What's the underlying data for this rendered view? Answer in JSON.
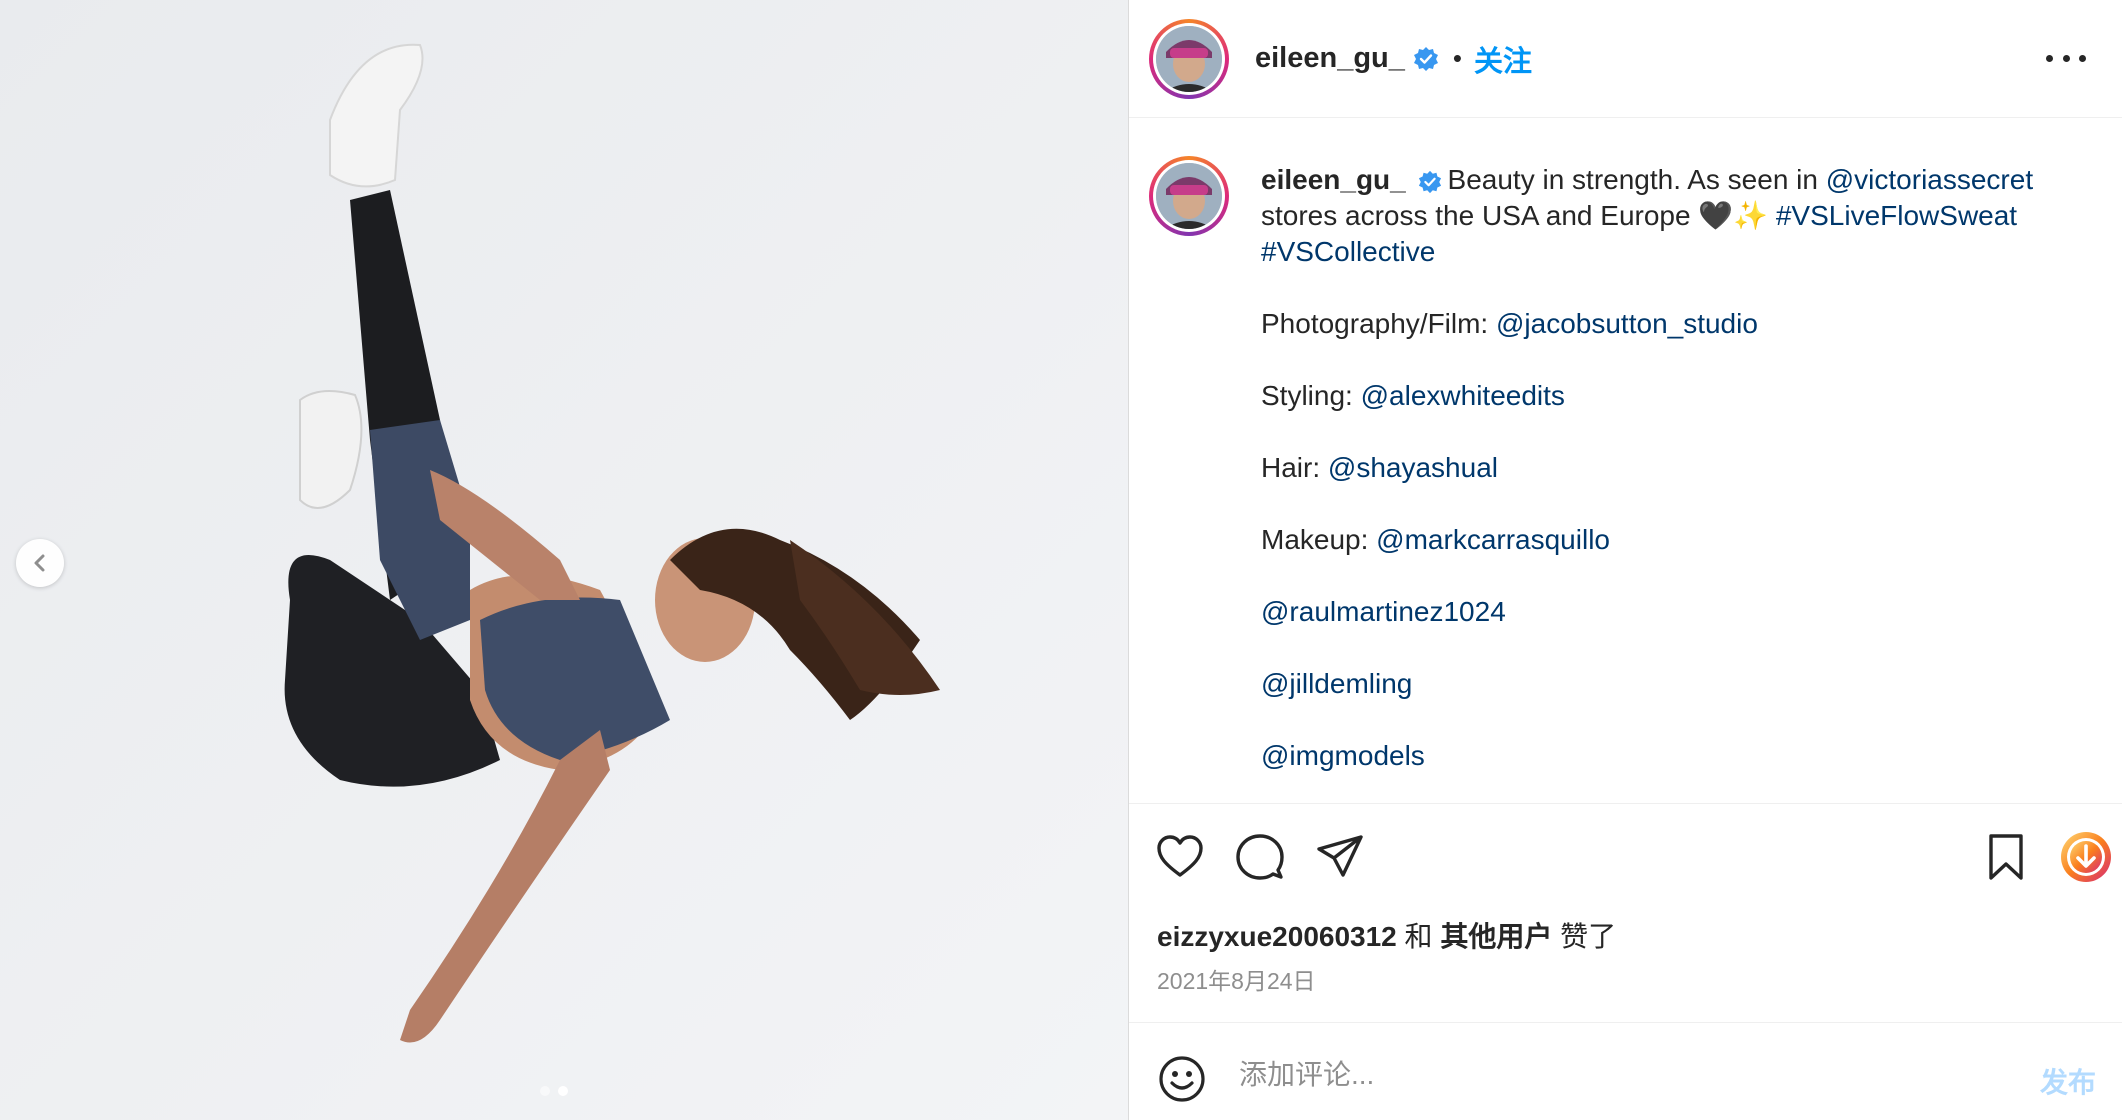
{
  "post": {
    "media": {
      "alt_description": "",
      "carousel_dots": 2,
      "active_dot": 2,
      "prev_icon": "chevron-left-icon"
    },
    "header": {
      "username": "eileen_gu_",
      "separator": "•",
      "follow_label": "关注",
      "more_icon": "more-horizontal-icon",
      "verified_icon": "verified-badge-icon"
    },
    "caption": {
      "username": "eileen_gu_",
      "line1_text": "Beauty in strength. As seen in ",
      "line1_mention": "@victoriassecret",
      "line2_text": "stores across the USA and Europe 🖤✨ ",
      "line2_hashtag": "#VSLiveFlowSweat",
      "line3_hashtag": "#VSCollective",
      "credits": [
        {
          "label": "Photography/Film: ",
          "mention": "@jacobsutton_studio"
        },
        {
          "label": "Styling: ",
          "mention": "@alexwhiteedits"
        },
        {
          "label": "Hair: ",
          "mention": "@shayashual"
        },
        {
          "label": "Makeup: ",
          "mention": "@markcarrasquillo"
        },
        {
          "label": "",
          "mention": "@raulmartinez1024"
        },
        {
          "label": "",
          "mention": "@jilldemling"
        },
        {
          "label": "",
          "mention": "@imgmodels"
        }
      ]
    },
    "actions": {
      "like_icon": "heart-icon",
      "comment_icon": "comment-icon",
      "share_icon": "send-icon",
      "save_icon": "bookmark-icon",
      "download_icon": "download-icon"
    },
    "likes": {
      "user": "eizzyxue20060312",
      "joiner": " 和 ",
      "others": "其他用户",
      "suffix": " 赞了"
    },
    "date": "2021年8月24日",
    "comment": {
      "placeholder": "添加评论...",
      "post_label": "发布",
      "emoji_icon": "smiley-icon"
    },
    "colors": {
      "accent": "#0095f6",
      "link": "#00376b",
      "post_disabled": "#b3dbff",
      "muted": "#8e8e8e"
    }
  }
}
